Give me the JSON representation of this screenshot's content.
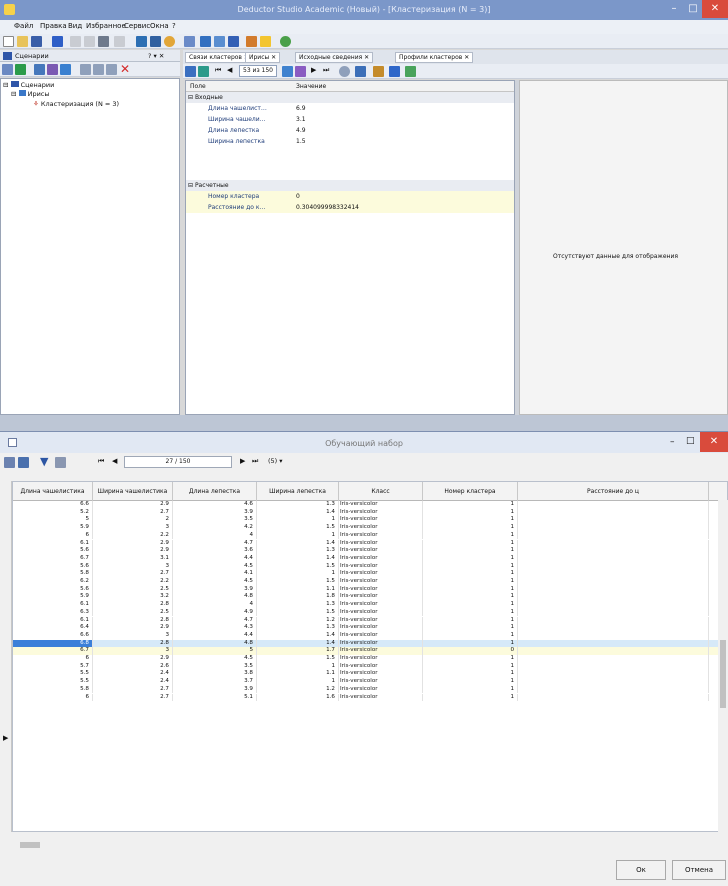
{
  "window": {
    "title": "Deductor Studio Academic (Новый) - [Кластеризация (N = 3)]",
    "min": "–",
    "max": "□",
    "close": "✕"
  },
  "menu": [
    "Файл",
    "Правка",
    "Вид",
    "Избранное",
    "Сервис",
    "Окна",
    "?"
  ],
  "scenarios_panel": {
    "title": "Сценарии",
    "pin": "? ▾ ✕",
    "tree": [
      "Сценарии",
      "Ирисы",
      "Кластеризация (N = 3)"
    ]
  },
  "doc_tabs": [
    "Связи кластеров ✕",
    "Ирисы ✕",
    "Исходные сведения ✕",
    "Профили кластеров ✕"
  ],
  "nav": {
    "pos": "53 из 150"
  },
  "props": {
    "head_field": "Поле",
    "head_value": "Значение",
    "group1": "Входные",
    "group1_rows": [
      {
        "name": "Длина чашелист…",
        "value": "6.9"
      },
      {
        "name": "Ширина чашели…",
        "value": "3.1"
      },
      {
        "name": "Длина лепестка",
        "value": "4.9"
      },
      {
        "name": "Ширина лепестка",
        "value": "1.5"
      }
    ],
    "group2": "Расчетные",
    "group2_rows": [
      {
        "name": "Номер кластера",
        "value": "0"
      },
      {
        "name": "Расстояние до к…",
        "value": "0.304099998332414"
      }
    ]
  },
  "right_message": "Отсутствуют данные для отображения",
  "dialog": {
    "title": "Обучающий набор",
    "pos": "27 / 150",
    "filter": "(5) ▾",
    "ok": "Ок",
    "cancel": "Отмена"
  },
  "columns": [
    "Длина чашелистика",
    "Ширина чашелистика",
    "Длина лепестка",
    "Ширина лепестка",
    "Класс",
    "Номер кластера",
    "Расстояние до ц"
  ],
  "rows": [
    [
      "6.6",
      "2.9",
      "4.6",
      "1.3",
      "Iris-versicolor",
      "1",
      ""
    ],
    [
      "5.2",
      "2.7",
      "3.9",
      "1.4",
      "Iris-versicolor",
      "1",
      ""
    ],
    [
      "5",
      "2",
      "3.5",
      "1",
      "Iris-versicolor",
      "1",
      ""
    ],
    [
      "5.9",
      "3",
      "4.2",
      "1.5",
      "Iris-versicolor",
      "1",
      ""
    ],
    [
      "6",
      "2.2",
      "4",
      "1",
      "Iris-versicolor",
      "1",
      ""
    ],
    [
      "6.1",
      "2.9",
      "4.7",
      "1.4",
      "Iris-versicolor",
      "1",
      ""
    ],
    [
      "5.6",
      "2.9",
      "3.6",
      "1.3",
      "Iris-versicolor",
      "1",
      ""
    ],
    [
      "6.7",
      "3.1",
      "4.4",
      "1.4",
      "Iris-versicolor",
      "1",
      ""
    ],
    [
      "5.6",
      "3",
      "4.5",
      "1.5",
      "Iris-versicolor",
      "1",
      ""
    ],
    [
      "5.8",
      "2.7",
      "4.1",
      "1",
      "Iris-versicolor",
      "1",
      ""
    ],
    [
      "6.2",
      "2.2",
      "4.5",
      "1.5",
      "Iris-versicolor",
      "1",
      ""
    ],
    [
      "5.6",
      "2.5",
      "3.9",
      "1.1",
      "Iris-versicolor",
      "1",
      ""
    ],
    [
      "5.9",
      "3.2",
      "4.8",
      "1.8",
      "Iris-versicolor",
      "1",
      ""
    ],
    [
      "6.1",
      "2.8",
      "4",
      "1.3",
      "Iris-versicolor",
      "1",
      ""
    ],
    [
      "6.3",
      "2.5",
      "4.9",
      "1.5",
      "Iris-versicolor",
      "1",
      ""
    ],
    [
      "6.1",
      "2.8",
      "4.7",
      "1.2",
      "Iris-versicolor",
      "1",
      ""
    ],
    [
      "6.4",
      "2.9",
      "4.3",
      "1.3",
      "Iris-versicolor",
      "1",
      ""
    ],
    [
      "6.6",
      "3",
      "4.4",
      "1.4",
      "Iris-versicolor",
      "1",
      ""
    ],
    [
      "6.8",
      "2.8",
      "4.8",
      "1.4",
      "Iris-versicolor",
      "1",
      ""
    ],
    [
      "6.7",
      "3",
      "5",
      "1.7",
      "Iris-versicolor",
      "0",
      ""
    ],
    [
      "6",
      "2.9",
      "4.5",
      "1.5",
      "Iris-versicolor",
      "1",
      ""
    ],
    [
      "5.7",
      "2.6",
      "3.5",
      "1",
      "Iris-versicolor",
      "1",
      ""
    ],
    [
      "5.5",
      "2.4",
      "3.8",
      "1.1",
      "Iris-versicolor",
      "1",
      ""
    ],
    [
      "5.5",
      "2.4",
      "3.7",
      "1",
      "Iris-versicolor",
      "1",
      ""
    ],
    [
      "5.8",
      "2.7",
      "3.9",
      "1.2",
      "Iris-versicolor",
      "1",
      ""
    ],
    [
      "6",
      "2.7",
      "5.1",
      "1.6",
      "Iris-versicolor",
      "1",
      ""
    ]
  ],
  "selected_row": 18,
  "highlight_row": 19,
  "colors": {
    "title_blue": "#7b97c9",
    "selection": "#d6e9f8",
    "yellow": "#fcfbdc",
    "cell_blue": "#3b7fd9"
  }
}
